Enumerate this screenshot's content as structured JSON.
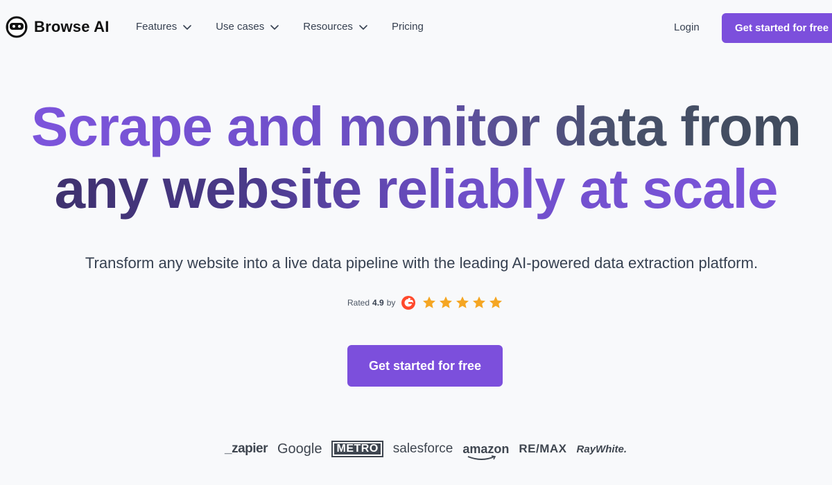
{
  "brand": {
    "name": "Browse AI",
    "logo_icon": "robot-face-icon"
  },
  "nav": {
    "items": [
      {
        "label": "Features",
        "has_dropdown": true
      },
      {
        "label": "Use cases",
        "has_dropdown": true
      },
      {
        "label": "Resources",
        "has_dropdown": true
      },
      {
        "label": "Pricing",
        "has_dropdown": false
      }
    ],
    "login_label": "Login",
    "cta_label": "Get started for free"
  },
  "hero": {
    "headline_line1_a": "Scrape and monitor data from",
    "headline_line2": "any website reliably at scale",
    "subheadline": "Transform any website into a live data pipeline with the leading AI-powered data extraction platform.",
    "rating": {
      "prefix": "Rated",
      "value": "4.9",
      "suffix": "by",
      "source_icon": "g2-icon",
      "stars": 5
    },
    "cta_label": "Get started for free"
  },
  "customers": [
    "_zapier",
    "Google",
    "METRO",
    "salesforce",
    "amazon",
    "RE/MAX",
    "RayWhite."
  ],
  "colors": {
    "accent": "#7c4fdc",
    "star": "#f5a623",
    "text": "#374151",
    "background": "#f8f9fb"
  }
}
